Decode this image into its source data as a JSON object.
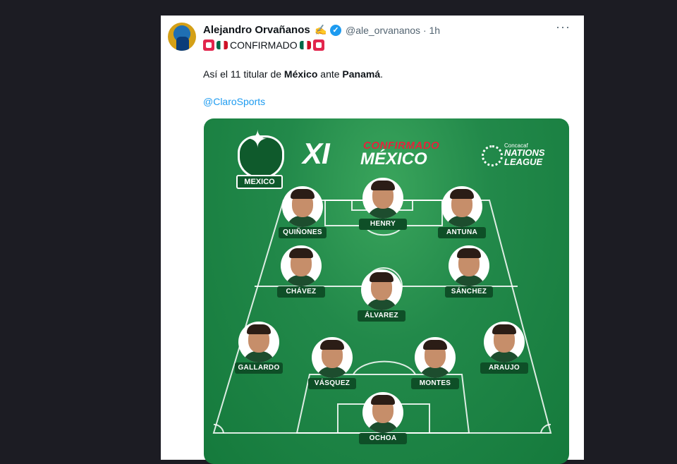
{
  "tweet": {
    "author_name": "Alejandro Orvañanos",
    "handle": "@ale_orvananos · 1h",
    "more_label": "···",
    "headline": "CONFIRMADO",
    "body_pre": "Así el 11 titular de ",
    "body_team1": "México",
    "body_mid": " ante ",
    "body_team2": "Panamá",
    "body_end": ".",
    "mention": "@ClaroSports",
    "icons": {
      "author_badge": "pen-icon",
      "verified": "verified-check-icon",
      "headline_emojis": [
        "siren-icon",
        "mexico-flag-icon",
        "mexico-flag-icon",
        "siren-icon"
      ]
    }
  },
  "graphic": {
    "title_xi": "XI",
    "title_confirmado": "CONFIRMADO",
    "title_mexico": "MÉXICO",
    "crest_label": "MEXICO",
    "league_small": "Concacaf",
    "league_line1": "NATIONS",
    "league_line2": "LEAGUE",
    "players": [
      "QUIÑONES",
      "HENRY",
      "ANTUNA",
      "CHÁVEZ",
      "SÁNCHEZ",
      "ÁLVAREZ",
      "GALLARDO",
      "VÁSQUEZ",
      "MONTES",
      "ARAUJO",
      "OCHOA"
    ]
  },
  "colors": {
    "link": "#1d9bf0",
    "pitch": "#22894a",
    "red": "#e4233c"
  }
}
